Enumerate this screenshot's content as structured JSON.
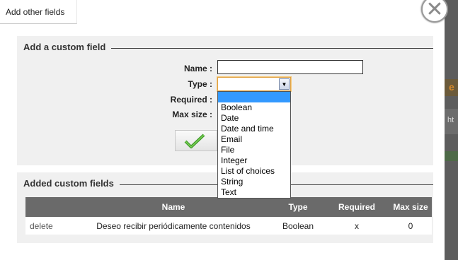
{
  "tab": {
    "label": "Add other fields"
  },
  "close_icon": "close-x-icon",
  "section_custom": {
    "legend": "Add a custom field"
  },
  "form": {
    "name_label": "Name :",
    "name_value": "",
    "type_label": "Type :",
    "type_value": "",
    "required_label": "Required :",
    "max_size_label": "Max size :"
  },
  "type_options": [
    "",
    "Boolean",
    "Date",
    "Date and time",
    "Email",
    "File",
    "Integer",
    "List of choices",
    "String",
    "Text"
  ],
  "save_icon": "checkmark-icon",
  "section_added": {
    "legend": "Added custom fields"
  },
  "table": {
    "headers": [
      "",
      "Name",
      "Type",
      "Required",
      "Max size"
    ],
    "rows": [
      {
        "action": "delete",
        "name": "Deseo recibir periódicamente contenidos",
        "type": "Boolean",
        "required": "x",
        "max_size": "0"
      }
    ]
  },
  "colors": {
    "accent_select": "#3399ff",
    "header_bg": "#6a6a6a",
    "panel_bg": "#f0f0f0",
    "checkmark": "#4aa82a"
  }
}
